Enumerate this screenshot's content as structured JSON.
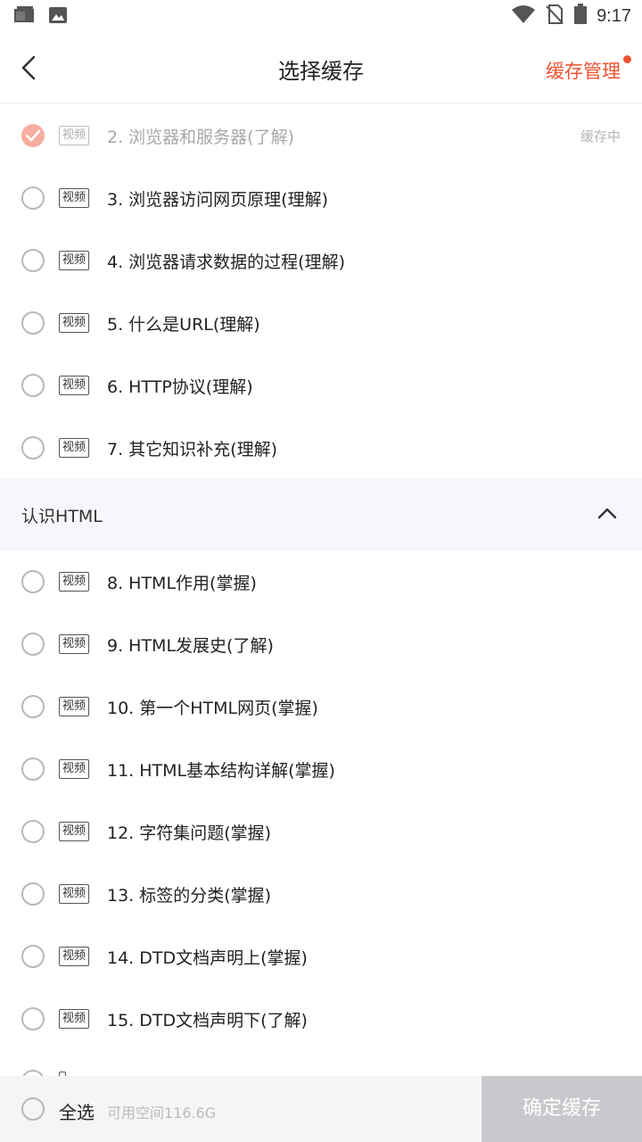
{
  "status_bar": {
    "time": "9:17",
    "left_icons": [
      "notification-app-icon",
      "image-icon"
    ],
    "right_icons": [
      "wifi-icon",
      "no-sim-icon",
      "battery-icon"
    ]
  },
  "header": {
    "title": "选择缓存",
    "manage_label": "缓存管理",
    "accent_color": "#f0522f"
  },
  "items_top": [
    {
      "tag": "视频",
      "label": "2. 浏览器和服务器(了解)",
      "status": "缓存中",
      "checked": true
    },
    {
      "tag": "视频",
      "label": "3. 浏览器访问网页原理(理解)"
    },
    {
      "tag": "视频",
      "label": "4. 浏览器请求数据的过程(理解)"
    },
    {
      "tag": "视频",
      "label": "5. 什么是URL(理解)"
    },
    {
      "tag": "视频",
      "label": "6. HTTP协议(理解)"
    },
    {
      "tag": "视频",
      "label": "7. 其它知识补充(理解)"
    }
  ],
  "section": {
    "label": "认识HTML"
  },
  "items_bottom": [
    {
      "tag": "视频",
      "label": "8. HTML作用(掌握)"
    },
    {
      "tag": "视频",
      "label": "9. HTML发展史(了解)"
    },
    {
      "tag": "视频",
      "label": "10. 第一个HTML网页(掌握)"
    },
    {
      "tag": "视频",
      "label": "11. HTML基本结构详解(掌握)"
    },
    {
      "tag": "视频",
      "label": "12. 字符集问题(掌握)"
    },
    {
      "tag": "视频",
      "label": "13. 标签的分类(掌握)"
    },
    {
      "tag": "视频",
      "label": "14. DTD文档声明上(掌握)"
    },
    {
      "tag": "视频",
      "label": "15. DTD文档声明下(了解)"
    }
  ],
  "bottom_bar": {
    "select_all_label": "全选",
    "space_info": "可用空间116.6G",
    "confirm_label": "确定缓存"
  }
}
